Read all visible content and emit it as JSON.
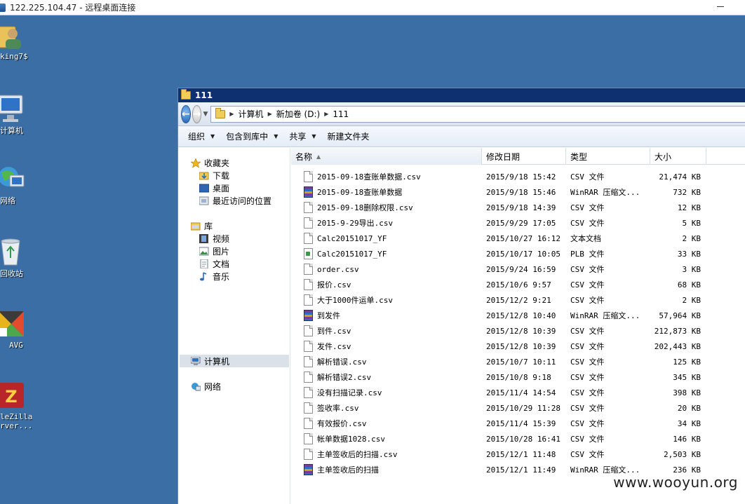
{
  "rdp": {
    "title": "122.225.104.47 - 远程桌面连接"
  },
  "desktop": {
    "icons": [
      {
        "label": "king7$",
        "icon": "user-folder-icon"
      },
      {
        "label": "计算机",
        "icon": "computer-icon"
      },
      {
        "label": "网络",
        "icon": "network-icon"
      },
      {
        "label": "回收站",
        "icon": "recycle-bin-icon"
      },
      {
        "label": "AVG",
        "icon": "avg-icon"
      },
      {
        "label": "leZilla",
        "label2": "rver...",
        "icon": "filezilla-icon"
      }
    ]
  },
  "window": {
    "title": "111",
    "address": {
      "segments": [
        "计算机",
        "新加卷 (D:)",
        "111"
      ]
    },
    "toolbar": {
      "organize": "组织",
      "include_library": "包含到库中",
      "share": "共享",
      "new_folder": "新建文件夹"
    },
    "nav": {
      "favorites": "收藏夹",
      "downloads": "下载",
      "desktop": "桌面",
      "recent": "最近访问的位置",
      "libraries": "库",
      "videos": "视频",
      "pictures": "图片",
      "documents": "文档",
      "music": "音乐",
      "computer": "计算机",
      "network": "网络"
    },
    "columns": {
      "name": "名称",
      "date": "修改日期",
      "type": "类型",
      "size": "大小"
    },
    "files": [
      {
        "name": "2015-09-18查账单数据.csv",
        "date": "2015/9/18 15:42",
        "type": "CSV 文件",
        "size": "21,474 KB",
        "icon": "doc"
      },
      {
        "name": "2015-09-18查账单数据",
        "date": "2015/9/18 15:46",
        "type": "WinRAR 压缩文...",
        "size": "732 KB",
        "icon": "rar"
      },
      {
        "name": "2015-09-18删除权限.csv",
        "date": "2015/9/18 14:39",
        "type": "CSV 文件",
        "size": "12 KB",
        "icon": "doc"
      },
      {
        "name": "2015-9-29导出.csv",
        "date": "2015/9/29 17:05",
        "type": "CSV 文件",
        "size": "5 KB",
        "icon": "doc"
      },
      {
        "name": "Calc20151017_YF",
        "date": "2015/10/27 16:12",
        "type": "文本文档",
        "size": "2 KB",
        "icon": "doc"
      },
      {
        "name": "Calc20151017_YF",
        "date": "2015/10/17 10:05",
        "type": "PLB 文件",
        "size": "33 KB",
        "icon": "plb"
      },
      {
        "name": "order.csv",
        "date": "2015/9/24 16:59",
        "type": "CSV 文件",
        "size": "3 KB",
        "icon": "doc"
      },
      {
        "name": "报价.csv",
        "date": "2015/10/6 9:57",
        "type": "CSV 文件",
        "size": "68 KB",
        "icon": "doc"
      },
      {
        "name": "大于1000件运单.csv",
        "date": "2015/12/2 9:21",
        "type": "CSV 文件",
        "size": "2 KB",
        "icon": "doc"
      },
      {
        "name": "到发件",
        "date": "2015/12/8 10:40",
        "type": "WinRAR 压缩文...",
        "size": "57,964 KB",
        "icon": "rar"
      },
      {
        "name": "到件.csv",
        "date": "2015/12/8 10:39",
        "type": "CSV 文件",
        "size": "212,873 KB",
        "icon": "doc"
      },
      {
        "name": "发件.csv",
        "date": "2015/12/8 10:39",
        "type": "CSV 文件",
        "size": "202,443 KB",
        "icon": "doc"
      },
      {
        "name": "解析错误.csv",
        "date": "2015/10/7 10:11",
        "type": "CSV 文件",
        "size": "125 KB",
        "icon": "doc"
      },
      {
        "name": "解析错误2.csv",
        "date": "2015/10/8 9:18",
        "type": "CSV 文件",
        "size": "345 KB",
        "icon": "doc"
      },
      {
        "name": "没有扫描记录.csv",
        "date": "2015/11/4 14:54",
        "type": "CSV 文件",
        "size": "398 KB",
        "icon": "doc"
      },
      {
        "name": "签收率.csv",
        "date": "2015/10/29 11:28",
        "type": "CSV 文件",
        "size": "20 KB",
        "icon": "doc"
      },
      {
        "name": "有效报价.csv",
        "date": "2015/11/4 15:39",
        "type": "CSV 文件",
        "size": "34 KB",
        "icon": "doc"
      },
      {
        "name": "帐单数据1028.csv",
        "date": "2015/10/28 16:41",
        "type": "CSV 文件",
        "size": "146 KB",
        "icon": "doc"
      },
      {
        "name": "主单签收后的扫描.csv",
        "date": "2015/12/1 11:48",
        "type": "CSV 文件",
        "size": "2,503 KB",
        "icon": "doc"
      },
      {
        "name": "主单签收后的扫描",
        "date": "2015/12/1 11:49",
        "type": "WinRAR 压缩文...",
        "size": "236 KB",
        "icon": "rar"
      }
    ]
  },
  "watermark": "www.wooyun.org"
}
